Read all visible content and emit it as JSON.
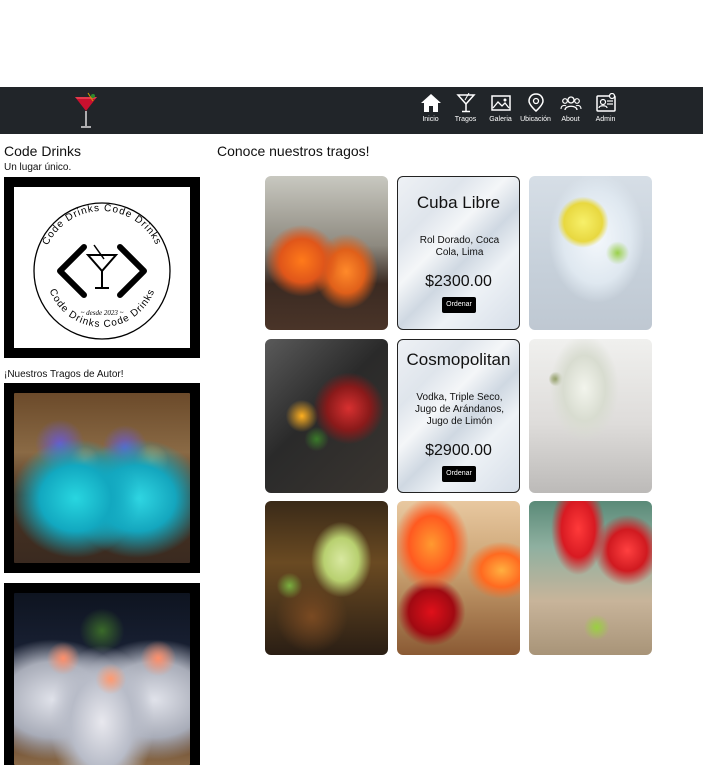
{
  "nav": {
    "items": [
      {
        "label": "Inicio",
        "icon": "home-icon"
      },
      {
        "label": "Tragos",
        "icon": "cocktail-icon"
      },
      {
        "label": "Galeria",
        "icon": "gallery-icon"
      },
      {
        "label": "Ubicación",
        "icon": "location-pin-icon"
      },
      {
        "label": "About",
        "icon": "users-icon"
      },
      {
        "label": "Admin",
        "icon": "admin-icon"
      }
    ]
  },
  "sidebar": {
    "brand": "Code Drinks",
    "tagline": "Un lugar único.",
    "logo_text_top": "Code Drinks   Code Drinks",
    "logo_text_bottom": "Code Drinks   Code Drinks",
    "logo_since": "~ desde 2023 ~",
    "autor_title": "¡Nuestros Tragos de Autor!"
  },
  "main": {
    "title": "Conoce nuestros tragos!",
    "cards": [
      {
        "name": "Cuba Libre",
        "ingredients": "Rol Dorado, Coca Cola, Lima",
        "price": "$2300.00",
        "button": "Ordenar"
      },
      {
        "name": "Cosmopolitan",
        "ingredients": "Vodka, Triple Seco, Jugo de Arándanos, Jugo de Limón",
        "price": "$2900.00",
        "button": "Ordenar"
      }
    ]
  },
  "colors": {
    "navbar": "#212529",
    "accent": "#c8102e"
  }
}
